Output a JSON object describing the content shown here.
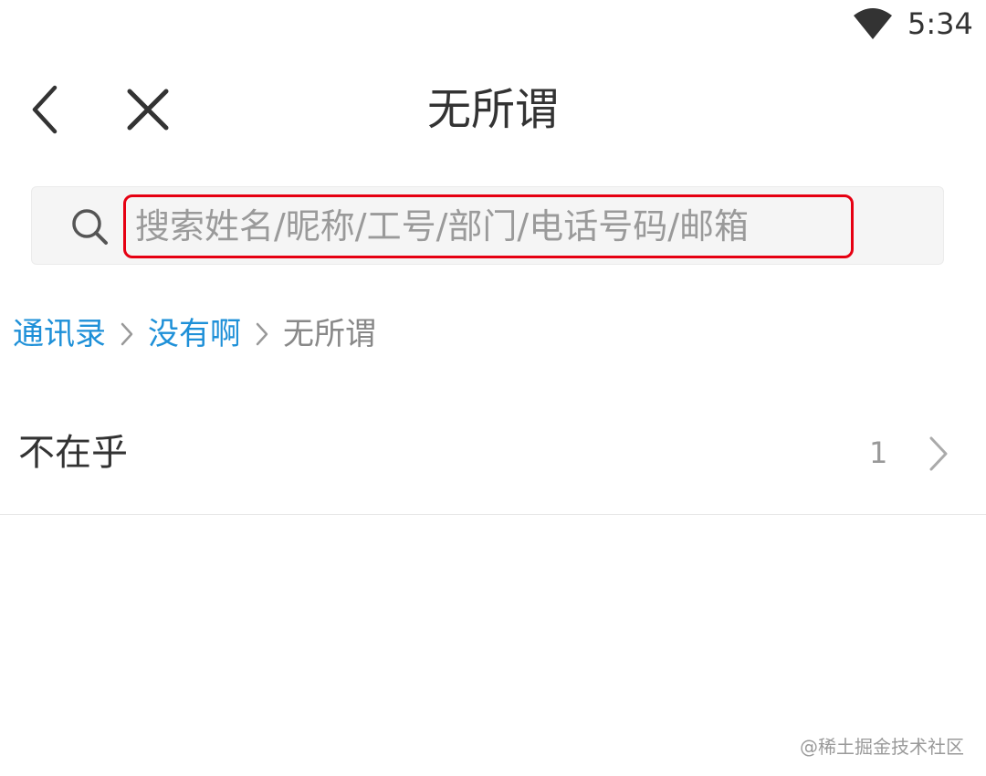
{
  "status_bar": {
    "time": "5:34",
    "wifi_icon": "wifi-icon"
  },
  "nav": {
    "title": "无所谓",
    "back_icon": "chevron-left-icon",
    "close_icon": "close-icon"
  },
  "search": {
    "placeholder": "搜索姓名/昵称/工号/部门/电话号码/邮箱",
    "value": "",
    "icon": "search-icon",
    "highlight_color": "#e60012"
  },
  "breadcrumb": {
    "items": [
      {
        "label": "通讯录",
        "link": true
      },
      {
        "label": "没有啊",
        "link": true
      },
      {
        "label": "无所谓",
        "link": false
      }
    ],
    "link_color": "#1e90d8"
  },
  "list": {
    "items": [
      {
        "name": "不在乎",
        "count": "1"
      }
    ]
  },
  "watermark": "@稀土掘金技术社区"
}
